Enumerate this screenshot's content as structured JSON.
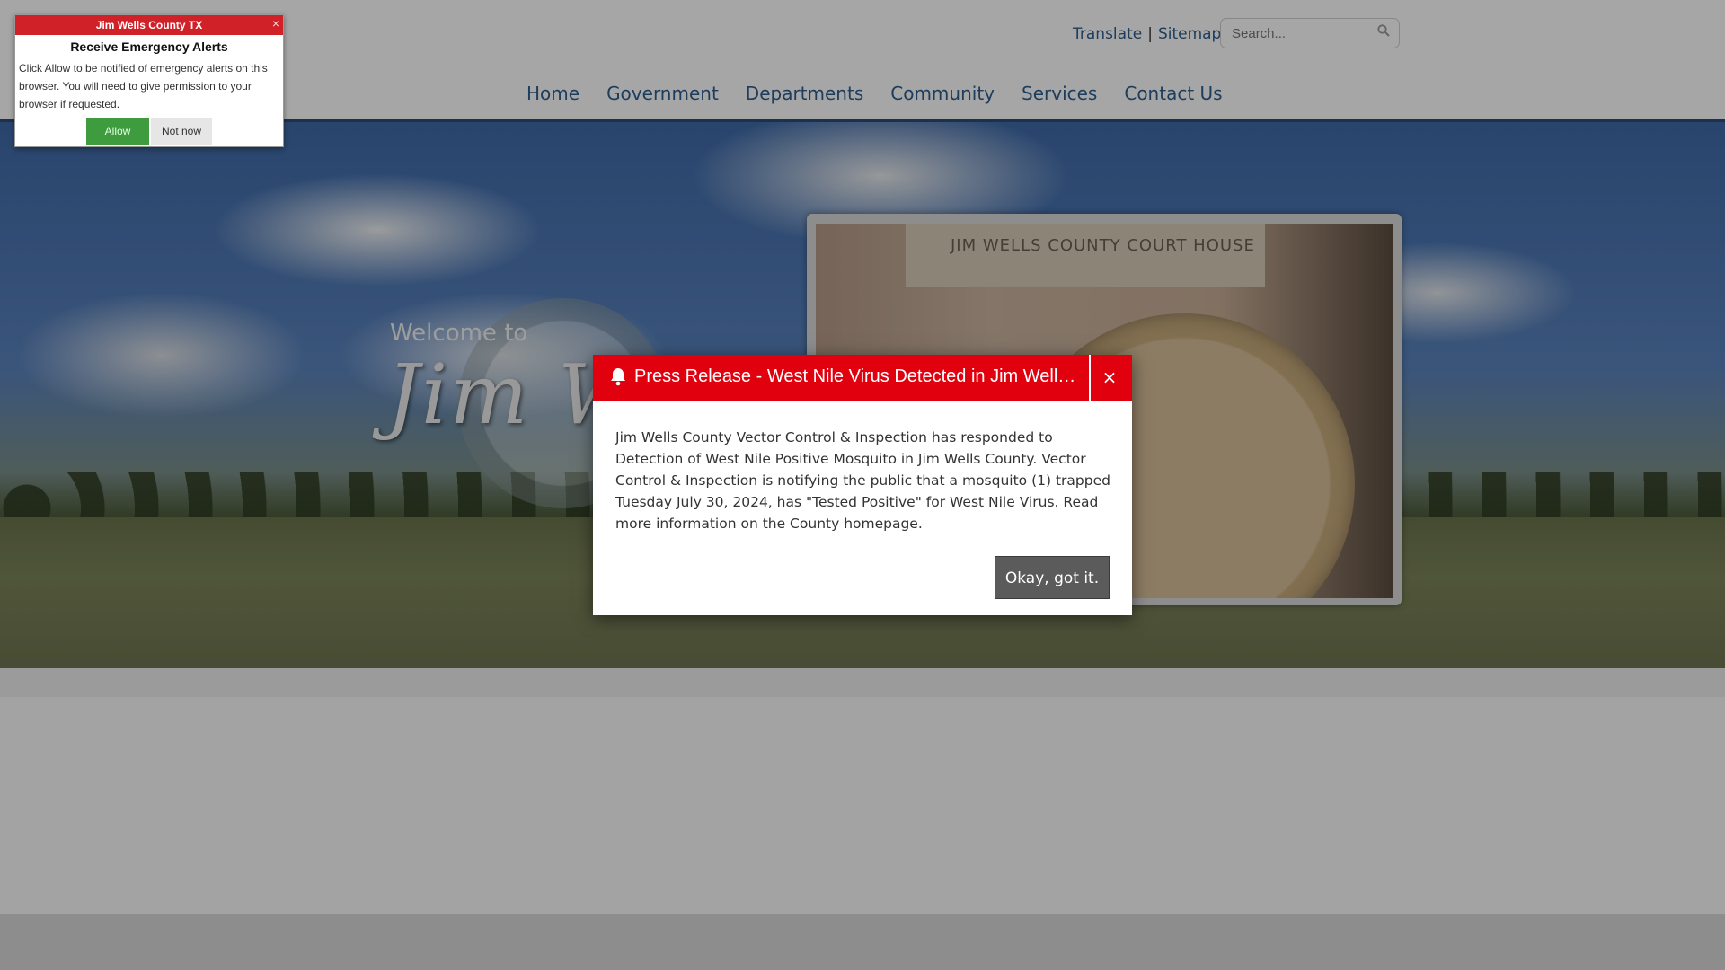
{
  "header": {
    "translate_label": "Translate",
    "separator": "|",
    "sitemap_label": "Sitemap",
    "search_placeholder": "Search..."
  },
  "nav": {
    "items": [
      "Home",
      "Government",
      "Departments",
      "Community",
      "Services",
      "Contact Us"
    ]
  },
  "hero": {
    "welcome_text": "Welcome to",
    "wordmark_text": "Jim Wells County",
    "photo_lintel_text": "JIM WELLS COUNTY COURT HOUSE"
  },
  "alert": {
    "header": "Jim Wells County TX",
    "close": "×",
    "title": "Receive Emergency Alerts",
    "body": "Click Allow to be notified of emergency alerts on this browser. You will need to give permission to your browser if requested.",
    "allow_label": "Allow",
    "not_now_label": "Not now"
  },
  "modal": {
    "title": "Press Release - West Nile Virus Detected in Jim Wells County",
    "close": "×",
    "body": "Jim Wells County Vector Control & Inspection has responded to Detection of West Nile Positive Mosquito in Jim Wells County.  Vector Control & Inspection is notifying the public that a mosquito (1) trapped Tuesday July 30, 2024, has \"Tested Positive\" for West Nile Virus.  Read more information on the County homepage.",
    "ok_label": "Okay, got it."
  },
  "colors": {
    "modal_header": "#e0000e",
    "alert_header": "#d02028",
    "allow_button": "#3e9b3e",
    "nav_link": "#2f5d8c"
  }
}
